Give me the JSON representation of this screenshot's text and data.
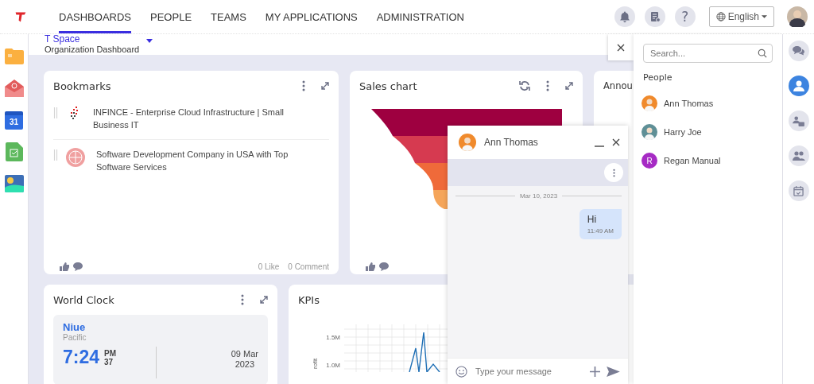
{
  "topbar": {
    "tabs": [
      {
        "label": "DASHBOARDS",
        "selected": true
      },
      {
        "label": "PEOPLE",
        "selected": false
      },
      {
        "label": "TEAMS",
        "selected": false
      },
      {
        "label": "MY APPLICATIONS",
        "selected": false
      },
      {
        "label": "ADMINISTRATION",
        "selected": false
      }
    ],
    "help": "?",
    "language": "English"
  },
  "apps": [
    {
      "kind": "folder"
    },
    {
      "kind": "mail"
    },
    {
      "kind": "calendar",
      "label": "31"
    },
    {
      "kind": "task"
    },
    {
      "kind": "image"
    }
  ],
  "header": {
    "space": "T Space",
    "dashboard": "Organization Dashboard"
  },
  "bookmarks": {
    "title": "Bookmarks",
    "items": [
      {
        "kind": "dots",
        "text": "INFINCE - Enterprise Cloud Infrastructure | Small Business IT"
      },
      {
        "kind": "globe",
        "text": "Software Development Company in USA with Top Software Services"
      }
    ],
    "likes": "0 Like",
    "comments": "0 Comment"
  },
  "sales_chart": {
    "title": "Sales chart"
  },
  "announcements": {
    "title": "Annou"
  },
  "world_clock": {
    "title": "World Clock",
    "city": "Niue",
    "region": "Pacific",
    "time": "7:24",
    "meridiem": "PM",
    "seconds": "37",
    "date": "09 Mar",
    "year": "2023"
  },
  "kpis": {
    "title": "KPIs",
    "yticks": [
      "1.5M",
      "1.0M"
    ],
    "ylabel": "rofit"
  },
  "chat": {
    "name": "Ann Thomas",
    "date": "Mar 10, 2023",
    "messages": [
      {
        "text": "Hi",
        "time": "11:49 AM"
      }
    ],
    "placeholder": "Type your message"
  },
  "people_panel": {
    "search_placeholder": "Search...",
    "heading": "People",
    "people": [
      {
        "name": "Ann Thomas",
        "kind": "photo",
        "color": "#f08a2c"
      },
      {
        "name": "Harry Joe",
        "kind": "photo",
        "color": "#5f8f96"
      },
      {
        "name": "Regan Manual",
        "kind": "initial",
        "initial": "R",
        "color": "#a62bc4"
      }
    ]
  },
  "right_rail": [
    {
      "kind": "chat",
      "selected": false
    },
    {
      "kind": "person",
      "selected": true
    },
    {
      "kind": "contacts",
      "selected": false
    },
    {
      "kind": "group",
      "selected": false
    },
    {
      "kind": "calendar",
      "selected": false
    }
  ]
}
